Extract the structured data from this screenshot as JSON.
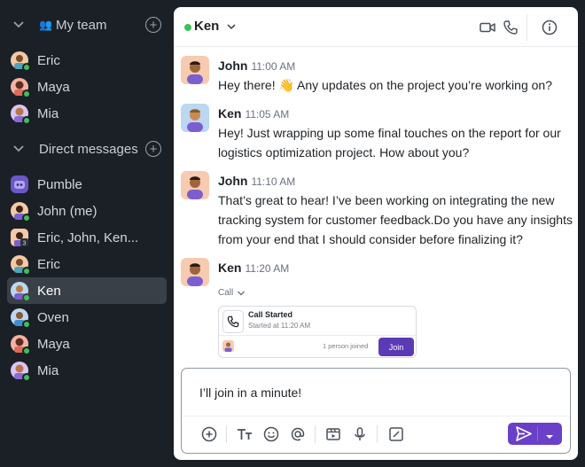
{
  "sidebar": {
    "my_team": {
      "title": "My team",
      "items": [
        {
          "label": "Eric"
        },
        {
          "label": "Maya"
        },
        {
          "label": "Mia"
        }
      ]
    },
    "direct_messages": {
      "title": "Direct messages",
      "items": [
        {
          "label": "Pumble"
        },
        {
          "label": "John (me)"
        },
        {
          "label": "Eric, John, Ken..."
        },
        {
          "label": "Eric"
        },
        {
          "label": "Ken",
          "active": true
        },
        {
          "label": "Oven"
        },
        {
          "label": "Maya"
        },
        {
          "label": "Mia"
        }
      ]
    }
  },
  "header": {
    "name": "Ken",
    "status": "online",
    "icons": [
      "video-icon",
      "phone-icon",
      "info-icon"
    ]
  },
  "messages": [
    {
      "author": "John",
      "time": "11:00 AM",
      "text": "Hey there! 👋 Any updates on the project you’re working on?"
    },
    {
      "author": "Ken",
      "time": "11:05 AM",
      "text": "Hey! Just wrapping up some final touches on the report for our logistics optimization project. How about you?"
    },
    {
      "author": "John",
      "time": "11:10 AM",
      "text": "That’s great to hear! I’ve been working on integrating the new tracking system for customer feedback.Do you have any insights from your end that I should consider before finalizing it?"
    },
    {
      "author": "Ken",
      "time": "11:20 AM"
    }
  ],
  "call": {
    "label": "Call",
    "title": "Call Started",
    "subtitle": "Started at 11:20 AM",
    "joined": "1 person joined",
    "join_button": "Join"
  },
  "composer": {
    "text": "I’ll join in a minute!",
    "toolbar": [
      "add-icon",
      "text-format-icon",
      "emoji-icon",
      "mention-icon",
      "media-icon",
      "mic-icon",
      "slash-command-icon"
    ]
  },
  "colors": {
    "sidebar_bg": "#1b2026",
    "accent": "#6a40c8",
    "online": "#3cc15a"
  }
}
